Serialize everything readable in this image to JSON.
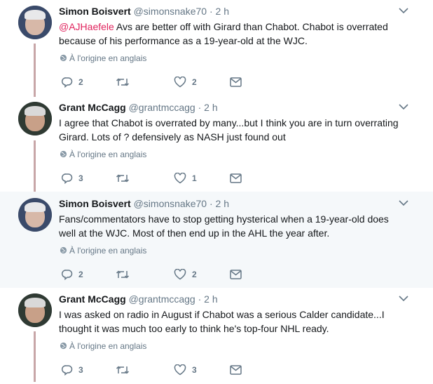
{
  "tweets": [
    {
      "name": "Simon Boisvert",
      "handle": "@simonsnake70",
      "time": "· 2 h",
      "mention": "@AJHaefele",
      "text": " Avs are better off with Girard than Chabot. Chabot is overrated because of his performance as a 19-year-old at the WJC.",
      "translate": "À l'origine en anglais",
      "reply_count": "2",
      "retweet_count": "",
      "like_count": "2",
      "highlighted": false
    },
    {
      "name": "Grant McCagg",
      "handle": "@grantmccagg",
      "time": "· 2 h",
      "mention": "",
      "text": "I agree that Chabot is overrated by many...but I think you are in turn overrating Girard. Lots of ? defensively as NASH just found out",
      "translate": "À l'origine en anglais",
      "reply_count": "3",
      "retweet_count": "",
      "like_count": "1",
      "highlighted": false
    },
    {
      "name": "Simon Boisvert",
      "handle": "@simonsnake70",
      "time": "· 2 h",
      "mention": "",
      "text": "Fans/commentators have to stop getting hysterical when a 19-year-old does well at the WJC. Most of then end up in the AHL the year after.",
      "translate": "À l'origine en anglais",
      "reply_count": "2",
      "retweet_count": "",
      "like_count": "2",
      "highlighted": true
    },
    {
      "name": "Grant McCagg",
      "handle": "@grantmccagg",
      "time": "· 2 h",
      "mention": "",
      "text": "I was asked on radio in August if Chabot was a serious Calder candidate...I thought it was much too early to think he's top-four NHL ready.",
      "translate": "À l'origine en anglais",
      "reply_count": "3",
      "retweet_count": "",
      "like_count": "3",
      "highlighted": false
    }
  ],
  "colors": {
    "mention": "#e0245e",
    "thread_line": "#c8a6a8",
    "secondary_text": "#657786",
    "highlight_bg": "#f5f8fa"
  },
  "icons": {
    "more": "chevron-down-icon",
    "translate": "globe-icon",
    "reply": "reply-icon",
    "retweet": "retweet-icon",
    "like": "heart-icon",
    "dm": "envelope-icon"
  }
}
